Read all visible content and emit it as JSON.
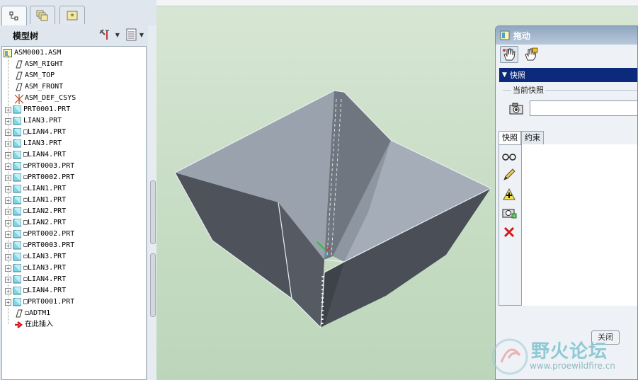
{
  "left_panel": {
    "tabs": [
      {
        "icon": "model-tree-tab-icon"
      },
      {
        "icon": "layers-tab-icon"
      },
      {
        "icon": "favorites-tab-icon"
      }
    ],
    "tree_title": "模型树",
    "tools": [
      {
        "icon": "settings-tools-icon"
      },
      {
        "icon": "show-list-icon"
      }
    ],
    "tree_items": [
      {
        "label": "ASM0001.ASM",
        "icon": "assembly-icon",
        "level": 0,
        "expand": false
      },
      {
        "label": "ASM_RIGHT",
        "icon": "datum-plane-icon",
        "level": 1,
        "expand": false
      },
      {
        "label": "ASM_TOP",
        "icon": "datum-plane-icon",
        "level": 1,
        "expand": false
      },
      {
        "label": "ASM_FRONT",
        "icon": "datum-plane-icon",
        "level": 1,
        "expand": false
      },
      {
        "label": "ASM_DEF_CSYS",
        "icon": "csys-icon",
        "level": 1,
        "expand": false
      },
      {
        "label": "PRT0001.PRT",
        "icon": "part-icon",
        "level": 1,
        "expand": true
      },
      {
        "label": "LIAN3.PRT",
        "icon": "part-icon",
        "level": 1,
        "expand": true
      },
      {
        "label": "□LIAN4.PRT",
        "icon": "part-icon",
        "level": 1,
        "expand": true
      },
      {
        "label": "LIAN3.PRT",
        "icon": "part-icon",
        "level": 1,
        "expand": true
      },
      {
        "label": "□LIAN4.PRT",
        "icon": "part-icon",
        "level": 1,
        "expand": true
      },
      {
        "label": "◻PRT0003.PRT",
        "icon": "part-icon",
        "level": 1,
        "expand": true
      },
      {
        "label": "◻PRT0002.PRT",
        "icon": "part-icon",
        "level": 1,
        "expand": true
      },
      {
        "label": "◻LIAN1.PRT",
        "icon": "part-icon",
        "level": 1,
        "expand": true
      },
      {
        "label": "◻LIAN1.PRT",
        "icon": "part-icon",
        "level": 1,
        "expand": true
      },
      {
        "label": "◻LIAN2.PRT",
        "icon": "part-icon",
        "level": 1,
        "expand": true
      },
      {
        "label": "□LIAN2.PRT",
        "icon": "part-icon",
        "level": 1,
        "expand": true
      },
      {
        "label": "◻PRT0002.PRT",
        "icon": "part-icon",
        "level": 1,
        "expand": true
      },
      {
        "label": "◻PRT0003.PRT",
        "icon": "part-icon",
        "level": 1,
        "expand": true
      },
      {
        "label": "◻LIAN3.PRT",
        "icon": "part-icon",
        "level": 1,
        "expand": true
      },
      {
        "label": "◻LIAN3.PRT",
        "icon": "part-icon",
        "level": 1,
        "expand": true
      },
      {
        "label": "◻LIAN4.PRT",
        "icon": "part-icon",
        "level": 1,
        "expand": true
      },
      {
        "label": "□LIAN4.PRT",
        "icon": "part-icon",
        "level": 1,
        "expand": true
      },
      {
        "label": "□PRT0001.PRT",
        "icon": "part-icon",
        "level": 1,
        "expand": true
      },
      {
        "label": "◻ADTM1",
        "icon": "datum-plane-icon",
        "level": 1,
        "expand": false
      },
      {
        "label": "在此插入",
        "icon": "insert-here-arrow-icon",
        "level": 1,
        "expand": false
      }
    ]
  },
  "drag_dialog": {
    "title": "拖动",
    "snapshot_section": "快照",
    "current_snapshot_label": "当前快照",
    "current_snapshot_value": "",
    "tabs": [
      "快照",
      "约束"
    ],
    "side_icons": [
      "view-glasses-icon",
      "edit-pencil-icon",
      "add-snapshot-icon",
      "camera-snapshot-icon",
      "delete-x-icon"
    ],
    "close_label": "关闭"
  },
  "watermark": {
    "text": "野火论坛",
    "url": "www.proewildfire.cn"
  },
  "colors": {
    "dialog_header": "#0b2a7b",
    "model_dark": "#4b5059",
    "model_light": "#a3acb6",
    "viewport_bg": "#c9dcc9"
  }
}
